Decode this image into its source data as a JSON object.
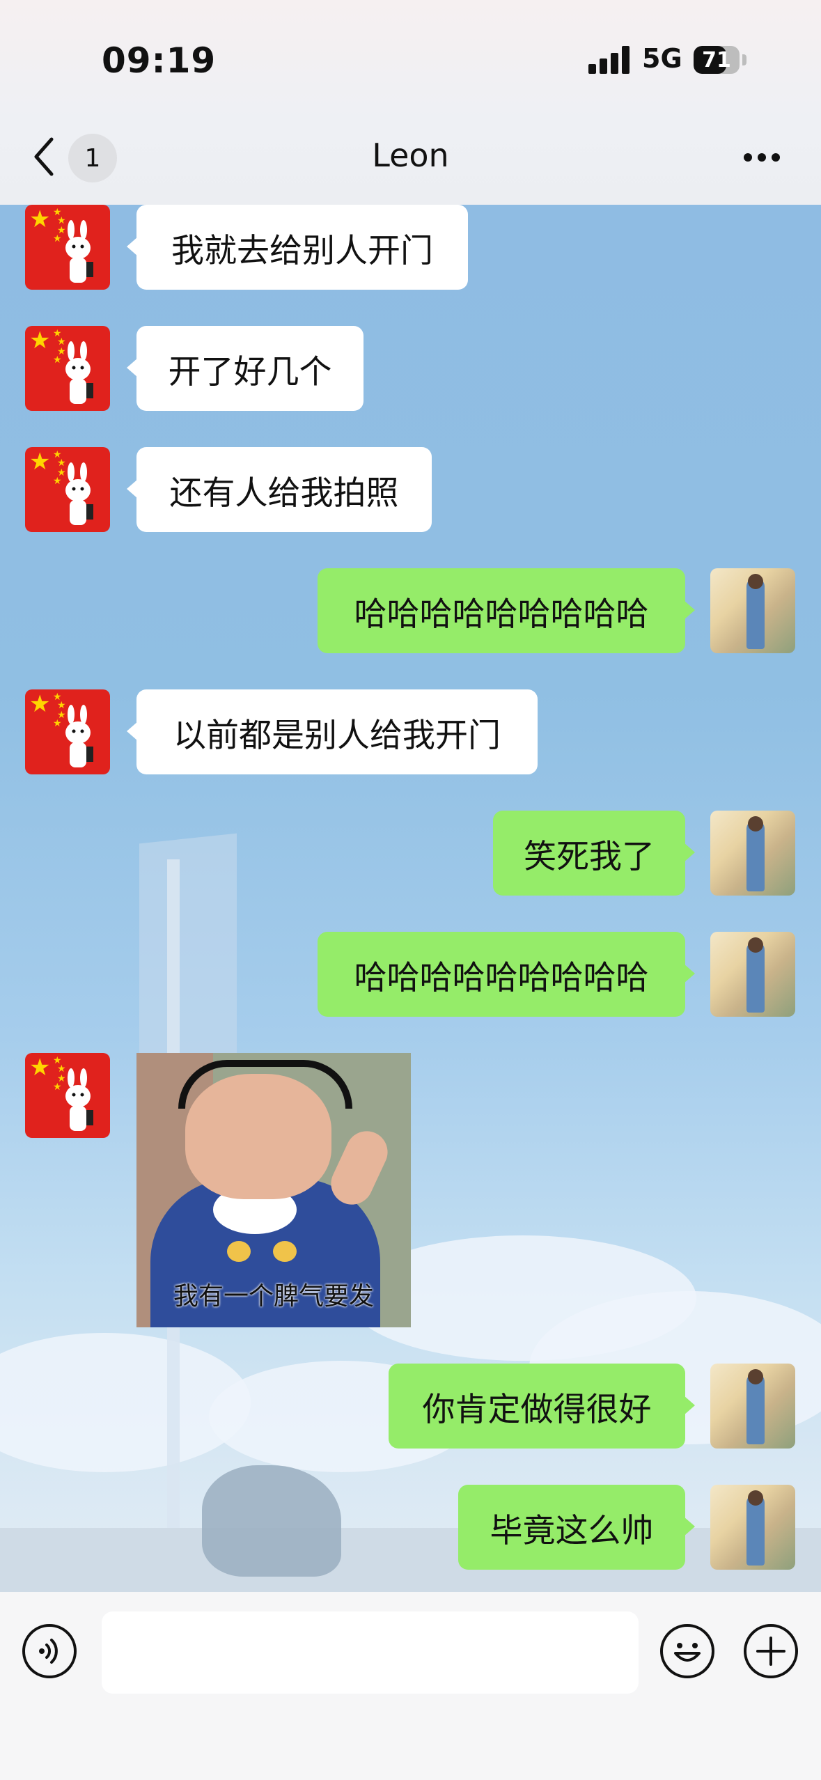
{
  "status_bar": {
    "time": "09:19",
    "network": "5G",
    "battery": "71",
    "battery_level": 0.71
  },
  "nav": {
    "back_count": "1",
    "title": "Leon"
  },
  "messages": [
    {
      "side": "in",
      "text": "我就去给别人开门"
    },
    {
      "side": "in",
      "text": "开了好几个"
    },
    {
      "side": "in",
      "text": "还有人给我拍照"
    },
    {
      "side": "out",
      "text": "哈哈哈哈哈哈哈哈哈"
    },
    {
      "side": "in",
      "text": "以前都是别人给我开门"
    },
    {
      "side": "out",
      "text": "笑死我了"
    },
    {
      "side": "out",
      "text": "哈哈哈哈哈哈哈哈哈"
    },
    {
      "side": "in",
      "sticker_caption": "我有一个脾气要发"
    },
    {
      "side": "out",
      "text": "你肯定做得很好"
    },
    {
      "side": "out",
      "text": "毕竟这么帅"
    }
  ],
  "input": {
    "value": ""
  },
  "icons": [
    "back-icon",
    "more-icon",
    "voice-icon",
    "emoji-icon",
    "plus-icon"
  ],
  "colors": {
    "incoming_bubble": "#ffffff",
    "outgoing_bubble": "#95ec69",
    "avatar_red": "#e0221d"
  }
}
